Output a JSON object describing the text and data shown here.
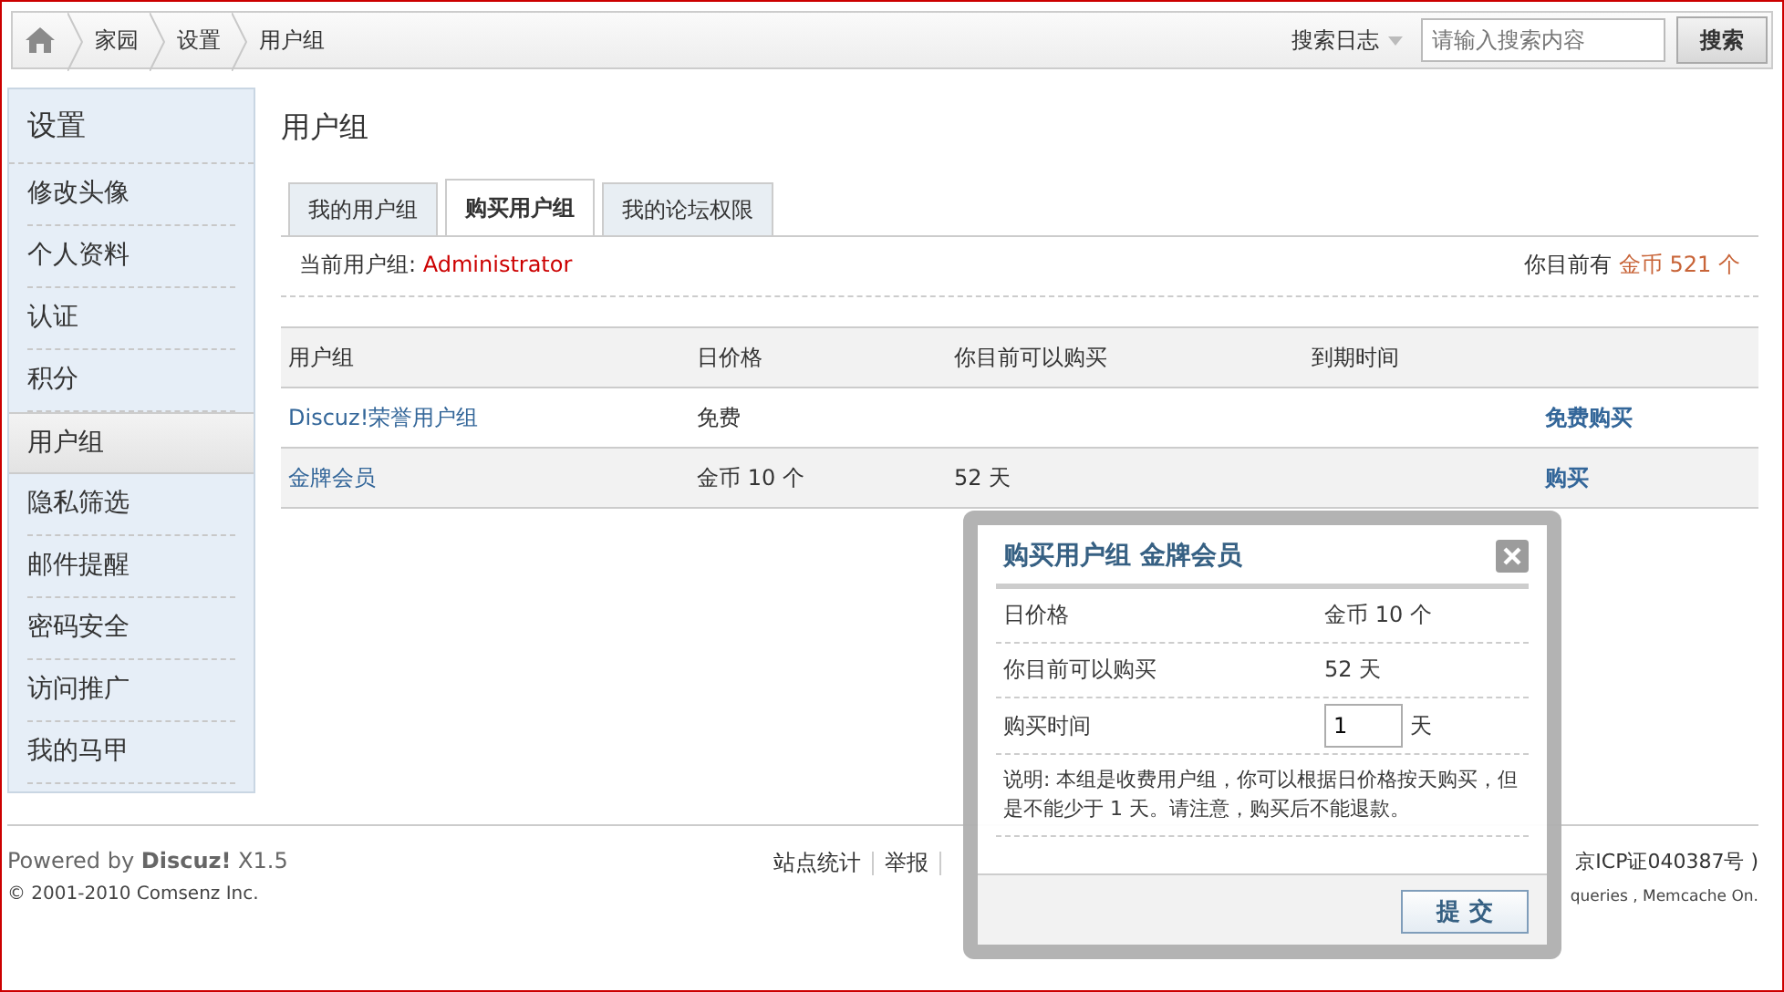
{
  "breadcrumb": [
    {
      "label": "家园"
    },
    {
      "label": "设置"
    },
    {
      "label": "用户组"
    }
  ],
  "search": {
    "type_label": "搜索日志",
    "placeholder": "请输入搜索内容",
    "button": "搜索"
  },
  "sidebar": {
    "title": "设置",
    "items": [
      {
        "label": "修改头像",
        "selected": false
      },
      {
        "label": "个人资料",
        "selected": false
      },
      {
        "label": "认证",
        "selected": false
      },
      {
        "label": "积分",
        "selected": false
      },
      {
        "label": "用户组",
        "selected": true
      },
      {
        "label": "隐私筛选",
        "selected": false
      },
      {
        "label": "邮件提醒",
        "selected": false
      },
      {
        "label": "密码安全",
        "selected": false
      },
      {
        "label": "访问推广",
        "selected": false
      },
      {
        "label": "我的马甲",
        "selected": false
      }
    ]
  },
  "page_title": "用户组",
  "tabs": [
    {
      "label": "我的用户组",
      "selected": false
    },
    {
      "label": "购买用户组",
      "selected": true
    },
    {
      "label": "我的论坛权限",
      "selected": false
    }
  ],
  "current_group": {
    "label": "当前用户组:",
    "value": "Administrator"
  },
  "balance": {
    "label": "你目前有",
    "value": "金币 521 个"
  },
  "table": {
    "columns": [
      "用户组",
      "日价格",
      "你目前可以购买",
      "到期时间"
    ],
    "rows": [
      {
        "group": "Discuz!荣誉用户组",
        "price": "免费",
        "action": "免费购买",
        "highlighted": false
      },
      {
        "group": "金牌会员",
        "price": "金币 10 个",
        "can_buy": "52 天",
        "action": "购买",
        "highlighted": true
      }
    ]
  },
  "modal": {
    "title": "购买用户组 金牌会员",
    "rows": [
      {
        "label": "日价格",
        "value": "金币 10 个"
      },
      {
        "label": "你目前可以购买",
        "value": "52 天"
      }
    ],
    "days": {
      "label": "购买时间",
      "value": "1",
      "unit": "天"
    },
    "note": "说明: 本组是收费用户组，你可以根据日价格按天购买，但是不能少于 1 天。请注意，购买后不能退款。",
    "submit": "提 交"
  },
  "footer": {
    "powered": "Powered by **Discuz!** X1.5",
    "copyright": "© 2001-2010 Comsenz Inc.",
    "links": [
      "站点统计",
      "举报"
    ],
    "icp": "京ICP证040387号 )",
    "stats": "queries , Memcache On."
  }
}
